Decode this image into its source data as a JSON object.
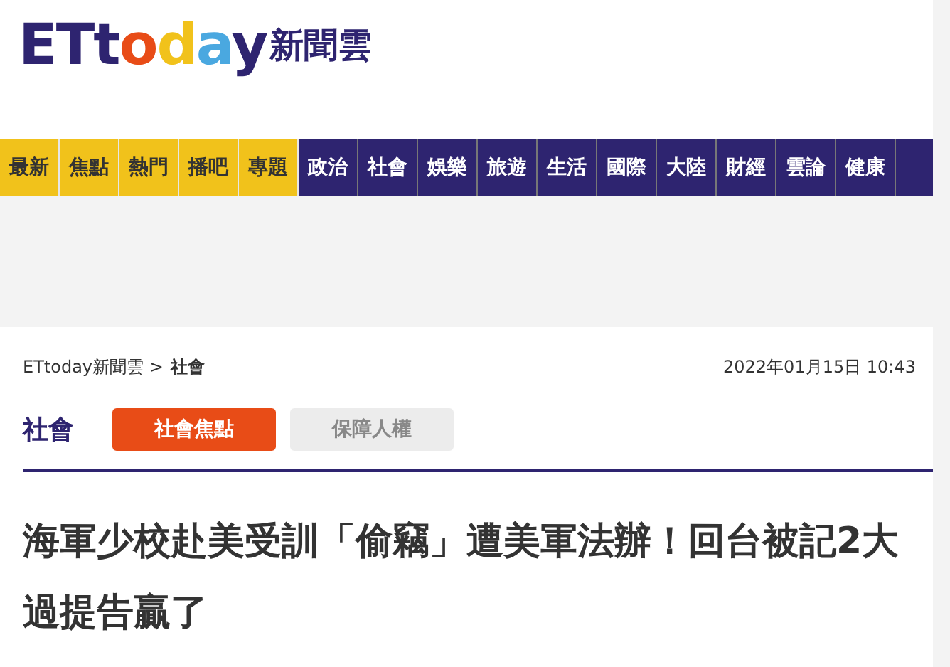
{
  "logo": {
    "wordmark": "ETtoday",
    "suffix": "新聞雲"
  },
  "nav": [
    {
      "label": "最新",
      "kind": "feature"
    },
    {
      "label": "焦點",
      "kind": "feature"
    },
    {
      "label": "熱門",
      "kind": "feature"
    },
    {
      "label": "播吧",
      "kind": "feature"
    },
    {
      "label": "專題",
      "kind": "feature"
    },
    {
      "label": "政治",
      "kind": "section"
    },
    {
      "label": "社會",
      "kind": "section"
    },
    {
      "label": "娛樂",
      "kind": "section"
    },
    {
      "label": "旅遊",
      "kind": "section"
    },
    {
      "label": "生活",
      "kind": "section"
    },
    {
      "label": "國際",
      "kind": "section"
    },
    {
      "label": "大陸",
      "kind": "section"
    },
    {
      "label": "財經",
      "kind": "section"
    },
    {
      "label": "雲論",
      "kind": "section"
    },
    {
      "label": "健康",
      "kind": "section"
    }
  ],
  "breadcrumb": {
    "home": "ETtoday新聞雲 >",
    "current": "社會"
  },
  "date": "2022年01月15日 10:43",
  "section": {
    "title": "社會",
    "tabs": [
      {
        "label": "社會焦點",
        "selected": true
      },
      {
        "label": "保障人權",
        "selected": false
      }
    ]
  },
  "headline": "海軍少校赴美受訓「偷竊」遭美軍法辦！回台被記2大過提告贏了"
}
